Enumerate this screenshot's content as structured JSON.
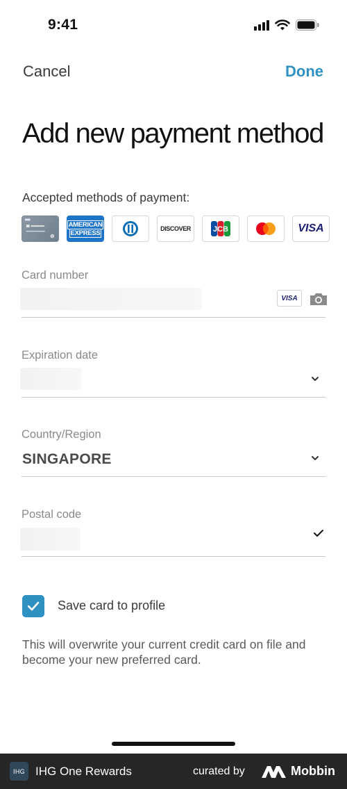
{
  "status_bar": {
    "time": "9:41"
  },
  "nav": {
    "cancel_label": "Cancel",
    "done_label": "Done"
  },
  "page": {
    "title": "Add new payment method",
    "accepted_label": "Accepted methods of payment:"
  },
  "accepted_cards": {
    "amex_line1": "AMERICAN",
    "amex_line2": "EXPRESS",
    "discover": "DISCOVER",
    "visa": "VISA"
  },
  "form": {
    "card_number": {
      "label": "Card number",
      "detected_brand": "VISA",
      "camera_icon": "camera-icon"
    },
    "expiration": {
      "label": "Expiration date",
      "icon": "chevron-down-icon"
    },
    "country": {
      "label": "Country/Region",
      "value": "SINGAPORE",
      "icon": "chevron-down-icon"
    },
    "postal": {
      "label": "Postal code",
      "icon": "checkmark-icon"
    }
  },
  "save_card": {
    "label": "Save card to profile",
    "checked": true
  },
  "note": "This will overwrite your current credit card on file and become your new preferred card.",
  "footer": {
    "logo_text": "IHG",
    "app_name": "IHG One Rewards",
    "curated_by": "curated by",
    "brand": "Mobbin"
  },
  "colors": {
    "accent": "#2f91c2",
    "footer_bg": "#262626"
  }
}
